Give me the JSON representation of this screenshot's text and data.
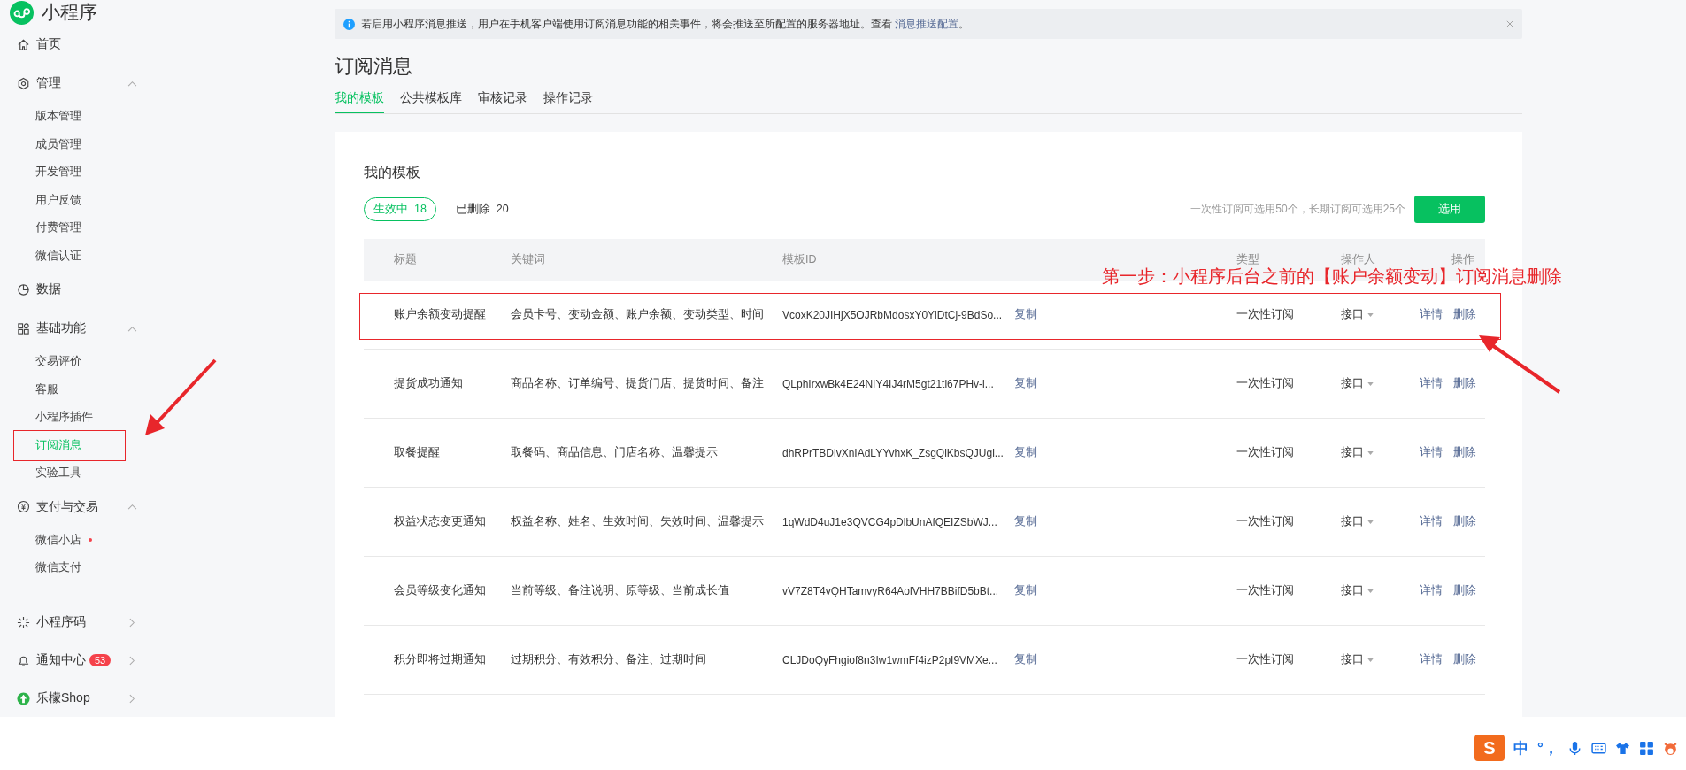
{
  "app": {
    "name": "小程序"
  },
  "sidebar": {
    "sections": [
      [
        {
          "label": "首页",
          "selected": false
        },
        {
          "label": "管理",
          "selected": false,
          "expanded": true,
          "children": [
            {
              "label": "版本管理",
              "selected": false
            },
            {
              "label": "成员管理",
              "selected": false
            },
            {
              "label": "开发管理",
              "selected": false
            },
            {
              "label": "用户反馈",
              "selected": false
            },
            {
              "label": "付费管理",
              "selected": false
            },
            {
              "label": "微信认证",
              "selected": false
            }
          ]
        },
        {
          "label": "数据",
          "selected": false
        },
        {
          "label": "基础功能",
          "selected": false,
          "expanded": true,
          "children": [
            {
              "label": "交易评价",
              "selected": false
            },
            {
              "label": "客服",
              "selected": false
            },
            {
              "label": "小程序插件",
              "selected": false
            },
            {
              "label": "订阅消息",
              "selected": true,
              "marked": true
            },
            {
              "label": "实验工具",
              "selected": false
            }
          ]
        },
        {
          "label": "支付与交易",
          "selected": false,
          "expanded": true,
          "children": [
            {
              "label": "微信小店",
              "selected": false,
              "dot": true
            },
            {
              "label": "微信支付",
              "selected": false
            }
          ]
        }
      ],
      [
        {
          "label": "小程序码",
          "selected": false,
          "expanded": false
        },
        {
          "label": "通知中心",
          "selected": false,
          "expanded": false,
          "badge": "53"
        },
        {
          "label": "乐檬Shop",
          "selected": false,
          "expanded": false
        }
      ]
    ]
  },
  "banner": {
    "text": "若启用小程序消息推送，用户在手机客户端使用订阅消息功能的相关事件，将会推送至所配置的服务器地址。查看 ",
    "link": "消息推送配置",
    "suffix": "。"
  },
  "page": {
    "title": "订阅消息"
  },
  "tabs": [
    {
      "label": "我的模板",
      "selected": true
    },
    {
      "label": "公共模板库",
      "selected": false
    },
    {
      "label": "审核记录",
      "selected": false
    },
    {
      "label": "操作记录",
      "selected": false
    }
  ],
  "card": {
    "title": "我的模板",
    "filters": [
      {
        "label": "生效中",
        "count": "18",
        "selected": true
      },
      {
        "label": "已删除",
        "count": "20",
        "selected": false
      }
    ],
    "quota_note": "一次性订阅可选用50个，长期订阅可选用25个",
    "add_button": "选用"
  },
  "table": {
    "columns": [
      "标题",
      "关键词",
      "模板ID",
      "",
      "类型",
      "操作人",
      "操作"
    ],
    "rows": [
      {
        "title": "账户余额变动提醒",
        "keywords": "会员卡号、变动金额、账户余额、变动类型、时间",
        "template_id": "VcoxK20JIHjX5OJRbMdosxY0YlDtCj-9BdSo...",
        "copy": "复制",
        "type": "一次性订阅",
        "operator": "接口",
        "actions": [
          "详情",
          "删除"
        ],
        "marked": true
      },
      {
        "title": "提货成功通知",
        "keywords": "商品名称、订单编号、提货门店、提货时间、备注",
        "template_id": "QLphIrxwBk4E24NIY4IJ4rM5gt21tl67PHv-i...",
        "copy": "复制",
        "type": "一次性订阅",
        "operator": "接口",
        "actions": [
          "详情",
          "删除"
        ],
        "marked": false
      },
      {
        "title": "取餐提醒",
        "keywords": "取餐码、商品信息、门店名称、温馨提示",
        "template_id": "dhRPrTBDlvXnIAdLYYvhxK_ZsgQiKbsQJUgi...",
        "copy": "复制",
        "type": "一次性订阅",
        "operator": "接口",
        "actions": [
          "详情",
          "删除"
        ],
        "marked": false
      },
      {
        "title": "权益状态变更通知",
        "keywords": "权益名称、姓名、生效时间、失效时间、温馨提示",
        "template_id": "1qWdD4uJ1e3QVCG4pDlbUnAfQEIZSbWJ...",
        "copy": "复制",
        "type": "一次性订阅",
        "operator": "接口",
        "actions": [
          "详情",
          "删除"
        ],
        "marked": false
      },
      {
        "title": "会员等级变化通知",
        "keywords": "当前等级、备注说明、原等级、当前成长值",
        "template_id": "vV7Z8T4vQHTamvyR64AolVHH7BBifD5bBt...",
        "copy": "复制",
        "type": "一次性订阅",
        "operator": "接口",
        "actions": [
          "详情",
          "删除"
        ],
        "marked": false
      },
      {
        "title": "积分即将过期通知",
        "keywords": "过期积分、有效积分、备注、过期时间",
        "template_id": "CLJDoQyFhgiof8n3Iw1wmFf4izP2pI9VMXe...",
        "copy": "复制",
        "type": "一次性订阅",
        "operator": "接口",
        "actions": [
          "详情",
          "删除"
        ],
        "marked": false
      }
    ]
  },
  "annotation": {
    "text": "第一步：小程序后台之前的【账户余额变动】订阅消息删除"
  },
  "ime": {
    "logo": "S",
    "items": [
      "中",
      "°，"
    ]
  }
}
